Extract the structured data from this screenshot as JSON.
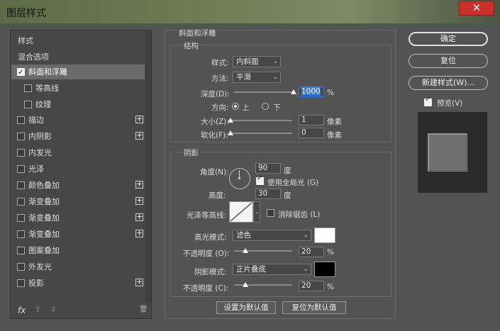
{
  "window": {
    "title": "图层样式",
    "close": "✕"
  },
  "left_list": {
    "items": [
      {
        "label": "样式",
        "checkbox": false,
        "checked": false,
        "plus": false,
        "indent": false,
        "selected": false
      },
      {
        "label": "混合选项",
        "checkbox": false,
        "checked": false,
        "plus": false,
        "indent": false,
        "selected": false
      },
      {
        "label": "斜面和浮雕",
        "checkbox": true,
        "checked": true,
        "plus": false,
        "indent": false,
        "selected": true
      },
      {
        "label": "等高线",
        "checkbox": true,
        "checked": false,
        "plus": false,
        "indent": true,
        "selected": false
      },
      {
        "label": "纹理",
        "checkbox": true,
        "checked": false,
        "plus": false,
        "indent": true,
        "selected": false
      },
      {
        "label": "描边",
        "checkbox": true,
        "checked": false,
        "plus": true,
        "indent": false,
        "selected": false
      },
      {
        "label": "内阴影",
        "checkbox": true,
        "checked": false,
        "plus": true,
        "indent": false,
        "selected": false
      },
      {
        "label": "内发光",
        "checkbox": true,
        "checked": false,
        "plus": false,
        "indent": false,
        "selected": false
      },
      {
        "label": "光泽",
        "checkbox": true,
        "checked": false,
        "plus": false,
        "indent": false,
        "selected": false
      },
      {
        "label": "颜色叠加",
        "checkbox": true,
        "checked": false,
        "plus": true,
        "indent": false,
        "selected": false
      },
      {
        "label": "渐变叠加",
        "checkbox": true,
        "checked": false,
        "plus": true,
        "indent": false,
        "selected": false
      },
      {
        "label": "渐变叠加",
        "checkbox": true,
        "checked": false,
        "plus": true,
        "indent": false,
        "selected": false
      },
      {
        "label": "渐变叠加",
        "checkbox": true,
        "checked": false,
        "plus": true,
        "indent": false,
        "selected": false
      },
      {
        "label": "图案叠加",
        "checkbox": true,
        "checked": false,
        "plus": false,
        "indent": false,
        "selected": false
      },
      {
        "label": "外发光",
        "checkbox": true,
        "checked": false,
        "plus": false,
        "indent": false,
        "selected": false
      },
      {
        "label": "投影",
        "checkbox": true,
        "checked": false,
        "plus": true,
        "indent": false,
        "selected": false
      }
    ],
    "footer": {
      "fx": "fx",
      "up": "⇧",
      "down": "⇩",
      "trash": "🗑"
    }
  },
  "bevel": {
    "heading": "斜面和浮雕",
    "structure": {
      "heading": "结构",
      "style_label": "样式:",
      "style_value": "内斜面",
      "method_label": "方法:",
      "method_value": "平滑",
      "depth_label": "深度(D):",
      "depth_value": "1000",
      "depth_unit": "%",
      "depth_level": 1.0,
      "direction_label": "方向:",
      "dir_up": "上",
      "dir_down": "下",
      "size_label": "大小(Z):",
      "size_value": "1",
      "size_unit": "像素",
      "size_level": 0.0,
      "soften_label": "软化(F):",
      "soften_value": "0",
      "soften_unit": "像素",
      "soften_level": 0.0
    },
    "shading": {
      "heading": "阴影",
      "angle_label": "角度(N):",
      "angle_value": "90",
      "angle_unit": "度",
      "global_light_label": "使用全局光 (G)",
      "global_light": true,
      "altitude_label": "高度:",
      "altitude_value": "30",
      "altitude_unit": "度",
      "gloss_label": "光泽等高线:",
      "antialias_label": "消除锯齿 (L)",
      "highlight_mode_label": "高光模式:",
      "highlight_mode": "滤色",
      "highlight_color": "#ffffff",
      "highlight_opacity_label": "不透明度 (O):",
      "highlight_opacity": "20",
      "highlight_opacity_unit": "%",
      "highlight_opacity_level": 0.2,
      "shadow_mode_label": "阴影模式:",
      "shadow_mode": "正片叠底",
      "shadow_color": "#000000",
      "shadow_opacity_label": "不透明度 (C):",
      "shadow_opacity": "20",
      "shadow_opacity_unit": "%",
      "shadow_opacity_level": 0.2
    },
    "set_default": "设置为默认值",
    "reset_default": "复位为默认值"
  },
  "right": {
    "ok": "确定",
    "reset": "复位",
    "new_style": "新建样式(W)...",
    "preview_label": "预览(V)",
    "preview": true
  }
}
